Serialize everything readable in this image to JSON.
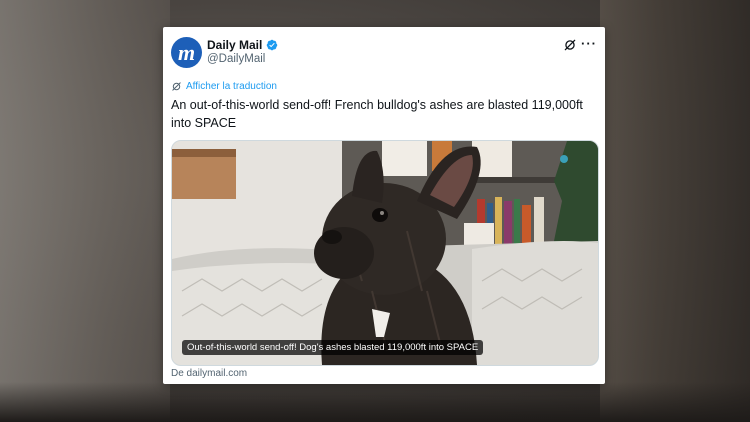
{
  "tweet": {
    "display_name": "Daily Mail",
    "handle": "@DailyMail",
    "avatar_letter": "m",
    "verified": true,
    "translate_label": "Afficher la traduction",
    "text": "An out-of-this-world send-off! French bulldog's ashes are blasted 119,000ft into SPACE",
    "card_caption": "Out-of-this-world send-off! Dog's ashes blasted 119,000ft into SPACE",
    "source": "De dailymail.com",
    "more_label": "···"
  },
  "icons": {
    "verified": "verified-badge-icon",
    "grok": "grok-icon",
    "more": "more-options-icon",
    "translate": "translate-icon"
  },
  "colors": {
    "accent": "#1d9bf0",
    "avatar_bg": "#1d5fb8",
    "text": "#0f1419",
    "muted": "#536471"
  }
}
